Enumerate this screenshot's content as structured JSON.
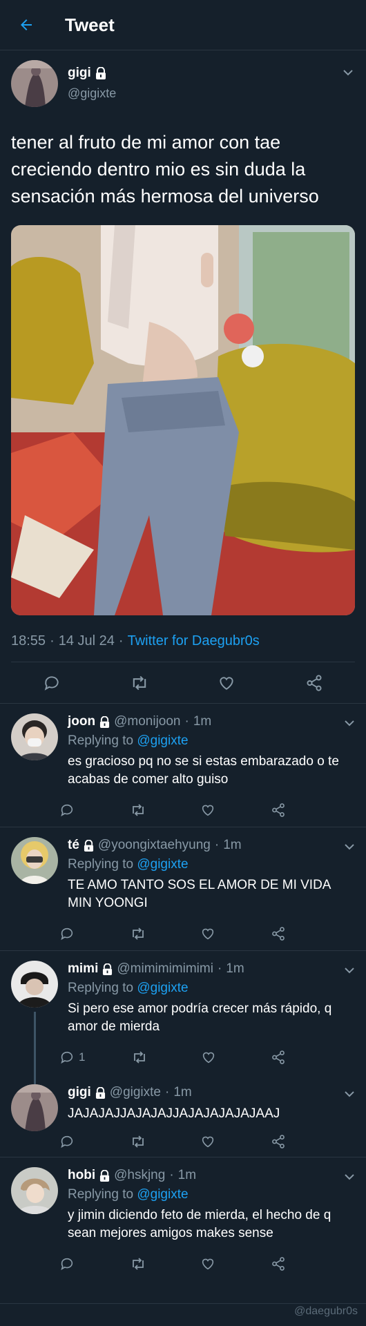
{
  "header": {
    "title": "Tweet"
  },
  "tweet": {
    "name": "gigi",
    "handle": "@gigixte",
    "text": "tener al fruto de mi amor con tae creciendo dentro mio es sin duda la sensación más hermosa del universo",
    "time": "18:55",
    "dot1": "·",
    "date": "14 Jul 24",
    "dot2": "·",
    "source": "Twitter for Daegubr0s"
  },
  "replies": [
    {
      "name": "joon",
      "handle": "@monijoon",
      "time": "1m",
      "replying_prefix": "Replying to",
      "replying_to": "@gigixte",
      "text": "es gracioso pq no se si estas embarazado o te acabas de comer alto guiso",
      "reply_count": ""
    },
    {
      "name": "té",
      "handle": "@yoongixtaehyung",
      "time": "1m",
      "replying_prefix": "Replying to",
      "replying_to": "@gigixte",
      "text": "TE AMO TANTO SOS EL AMOR DE MI VIDA MIN YOONGI",
      "reply_count": ""
    },
    {
      "name": "mimi",
      "handle": "@mimimimimimi",
      "time": "1m",
      "replying_prefix": "Replying to",
      "replying_to": "@gigixte",
      "text": "Si pero ese amor podría crecer más rápido, q amor de mierda",
      "reply_count": "1"
    },
    {
      "name": "gigi",
      "handle": "@gigixte",
      "time": "1m",
      "text": "JAJAJAJJAJAJAJJAJAJAJAJAJAAJ",
      "reply_count": ""
    },
    {
      "name": "hobi",
      "handle": "@hskjng",
      "time": "1m",
      "replying_prefix": "Replying to",
      "replying_to": "@gigixte",
      "text": "y jimin diciendo feto de mierda, el hecho de q sean mejores amigos makes sense",
      "reply_count": ""
    }
  ],
  "watermark": "@daegubr0s",
  "sep": "·",
  "colors": {
    "background": "#15202b",
    "accent": "#1da1f2",
    "muted": "#8899a6",
    "border": "#2a3642"
  },
  "icons": [
    "back-arrow-icon",
    "lock-icon",
    "chevron-down-icon",
    "reply-icon",
    "retweet-icon",
    "like-icon",
    "share-icon"
  ]
}
